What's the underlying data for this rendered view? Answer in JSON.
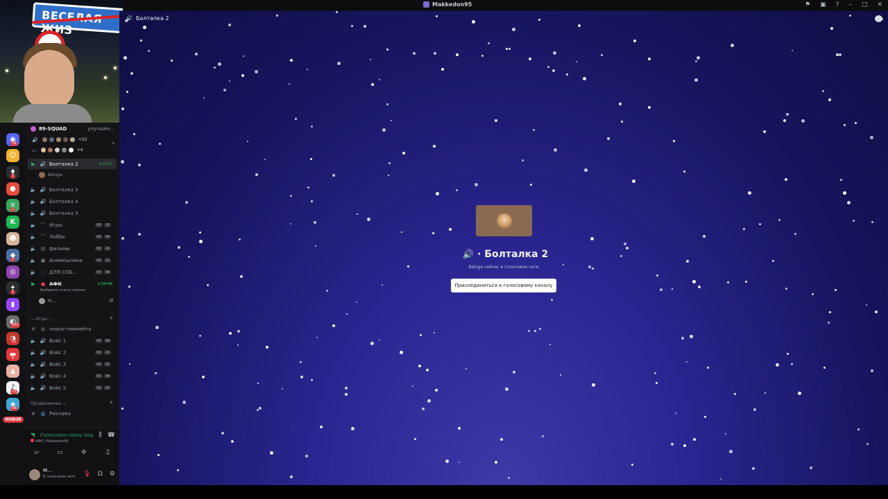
{
  "window": {
    "title": "Makkedon95"
  },
  "header": {
    "channel_name": "Болталка 2"
  },
  "guild": {
    "name": "89-SQUAD",
    "boost_text": "улучшен...",
    "row1_more": "+22",
    "row2_more": "+4"
  },
  "server_rail": {
    "badges": [
      "19",
      "7",
      "1",
      "2",
      "1",
      "603",
      "21",
      "6",
      "12",
      "69"
    ],
    "new_label": "НОВОЕ"
  },
  "channels": {
    "boltalka2": {
      "label": "Болталка 2",
      "timer": "4:33:55"
    },
    "member_beluga": "Beluga",
    "boltalka3": "Болталка 3",
    "boltalka4": "Болталка 4",
    "boltalka5": "Болталка 5",
    "igry": {
      "label": "Игры",
      "a": "00",
      "b": "10"
    },
    "lobbi": {
      "label": "Лобби",
      "a": "00",
      "b": "04"
    },
    "filmy": {
      "label": "фильмы",
      "a": "00",
      "b": "10"
    },
    "animeshniki": {
      "label": "Анимешники",
      "a": "00",
      "b": "10"
    },
    "dlya_sob": {
      "label": "ДЛЯ СОБ...",
      "a": "00",
      "b": "99"
    },
    "afk": {
      "label": "АФК",
      "timer": "1:54:48",
      "status_hint": "Выберите статус канала"
    },
    "member_m": "М..."
  },
  "games_category": {
    "name": "Игры",
    "search": "поиск-тиммейта",
    "voice1": {
      "label": "Войс 1",
      "a": "00",
      "b": "99"
    },
    "voice2": {
      "label": "Войс 2",
      "a": "00",
      "b": "10"
    },
    "voice3": {
      "label": "Войс 3",
      "a": "00",
      "b": "05"
    },
    "voice4": {
      "label": "Войс 4",
      "a": "00",
      "b": "04"
    },
    "voice5": {
      "label": "Войс 5",
      "a": "00",
      "b": "02"
    }
  },
  "promo_category": {
    "name": "Продвижение",
    "ads": "Реклама"
  },
  "voice_panel": {
    "status": "Голосовая связь подключена",
    "sub": "АФК / Makkedon95"
  },
  "user_panel": {
    "name": "М...",
    "sub": "В голосовом чате"
  },
  "main": {
    "title": "Болталка 2",
    "subtitle": "Beluga сейчас в голосовом чате",
    "join_button": "Присоединиться к голосовому каналу"
  },
  "webcam": {
    "sign_text": "ВЕСЕЛАЯ ЖИЗ"
  },
  "colors": {
    "accent_green": "#23a55a",
    "muted_red": "#f23f43",
    "background_top": "#0f0e44",
    "background_glow": "#3f39a8"
  }
}
